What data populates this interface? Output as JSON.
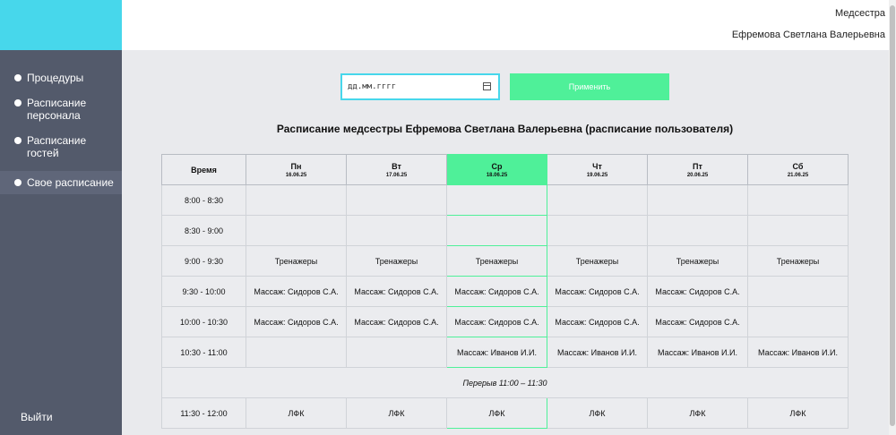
{
  "user": {
    "role": "Медсестра",
    "name": "Ефремова Светлана Валерьевна"
  },
  "sidebar": {
    "items": [
      {
        "label": "Процедуры"
      },
      {
        "label": "Расписание персонала"
      },
      {
        "label": "Расписание гостей"
      },
      {
        "label": "Свое расписание"
      }
    ],
    "logout": "Выйти"
  },
  "filter": {
    "date_placeholder": "дд.мм.гггг",
    "apply_label": "Применить"
  },
  "page_title": "Расписание медсестры Ефремова Светлана Валерьевна (расписание пользователя)",
  "schedule": {
    "time_header": "Время",
    "days": [
      {
        "name": "Пн",
        "date": "16.06.25"
      },
      {
        "name": "Вт",
        "date": "17.06.25"
      },
      {
        "name": "Ср",
        "date": "18.06.25"
      },
      {
        "name": "Чт",
        "date": "19.06.25"
      },
      {
        "name": "Пт",
        "date": "20.06.25"
      },
      {
        "name": "Сб",
        "date": "21.06.25"
      }
    ],
    "today_index": 2,
    "rows": [
      {
        "time": "8:00 - 8:30",
        "cells": [
          "",
          "",
          "",
          "",
          "",
          ""
        ]
      },
      {
        "time": "8:30 - 9:00",
        "cells": [
          "",
          "",
          "",
          "",
          "",
          ""
        ]
      },
      {
        "time": "9:00 - 9:30",
        "cells": [
          "Тренажеры",
          "Тренажеры",
          "Тренажеры",
          "Тренажеры",
          "Тренажеры",
          "Тренажеры"
        ]
      },
      {
        "time": "9:30 - 10:00",
        "cells": [
          "Массаж: Сидоров С.А.",
          "Массаж: Сидоров С.А.",
          "Массаж: Сидоров С.А.",
          "Массаж: Сидоров С.А.",
          "Массаж: Сидоров С.А.",
          ""
        ]
      },
      {
        "time": "10:00 - 10:30",
        "cells": [
          "Массаж: Сидоров С.А.",
          "Массаж: Сидоров С.А.",
          "Массаж: Сидоров С.А.",
          "Массаж: Сидоров С.А.",
          "Массаж: Сидоров С.А.",
          ""
        ]
      },
      {
        "time": "10:30 - 11:00",
        "cells": [
          "",
          "",
          "Массаж: Иванов И.И.",
          "Массаж: Иванов И.И.",
          "Массаж: Иванов И.И.",
          "Массаж: Иванов И.И."
        ]
      },
      {
        "break": "Перерыв 11:00 – 11:30"
      },
      {
        "time": "11:30 - 12:00",
        "cells": [
          "ЛФК",
          "ЛФК",
          "ЛФК",
          "ЛФК",
          "ЛФК",
          "ЛФК"
        ]
      }
    ]
  },
  "colors": {
    "accent_cyan": "#47d7eb",
    "accent_green": "#4ff099",
    "sidebar_bg": "#535a6b"
  }
}
